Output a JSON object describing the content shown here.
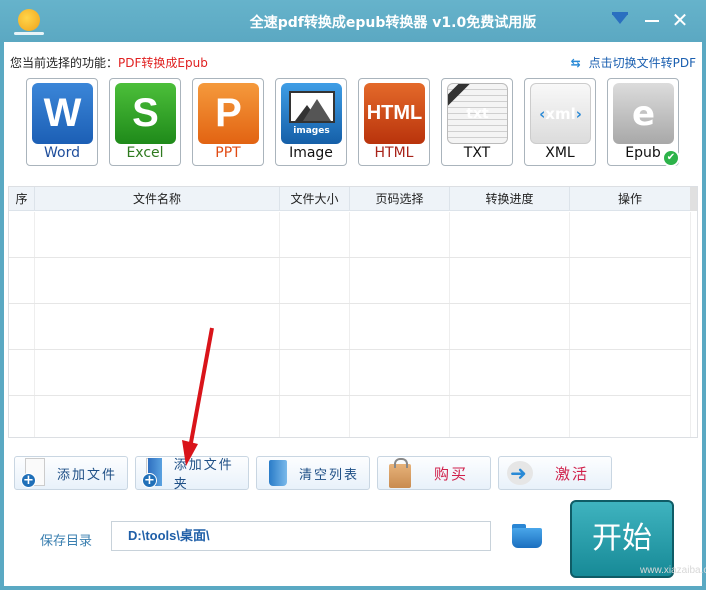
{
  "window": {
    "title": "全速pdf转换成epub转换器 v1.0免费试用版",
    "controls": {
      "menu": "menu-icon",
      "minimize": "minimize-icon",
      "close": "✕"
    }
  },
  "function_bar": {
    "label": "您当前选择的功能：",
    "value": "PDF转换成Epub",
    "switch_link": "点击切换文件转PDF",
    "switch_icon": "⇆"
  },
  "formats": [
    {
      "label": "Word",
      "glyph": "W",
      "color": "#1f4e9c"
    },
    {
      "label": "Excel",
      "glyph": "S",
      "color": "#2f7a1f"
    },
    {
      "label": "PPT",
      "glyph": "P",
      "color": "#e04a12"
    },
    {
      "label": "Image",
      "glyph": "images",
      "color": "#111111"
    },
    {
      "label": "HTML",
      "glyph": "HTML",
      "color": "#a8231a"
    },
    {
      "label": "TXT",
      "glyph": "txt",
      "color": "#111111"
    },
    {
      "label": "XML",
      "glyph": "xml",
      "color": "#111111"
    },
    {
      "label": "Epub",
      "glyph": "e",
      "color": "#111111",
      "selected": true
    }
  ],
  "table": {
    "columns": [
      "序",
      "文件名称",
      "文件大小",
      "页码选择",
      "转换进度",
      "操作"
    ],
    "rows": []
  },
  "actions": [
    {
      "label": "添加文件",
      "icon": "add-file-icon"
    },
    {
      "label": "添加文件夹",
      "icon": "add-folder-icon"
    },
    {
      "label": "清空列表",
      "icon": "trash-icon"
    },
    {
      "label": "购买",
      "icon": "shopping-bag-icon"
    },
    {
      "label": "激活",
      "icon": "activate-arrow-icon"
    }
  ],
  "save": {
    "label": "保存目录",
    "path": "D:\\tools\\桌面\\"
  },
  "start_button": "开始",
  "watermark": "www.xiazaiba.com"
}
